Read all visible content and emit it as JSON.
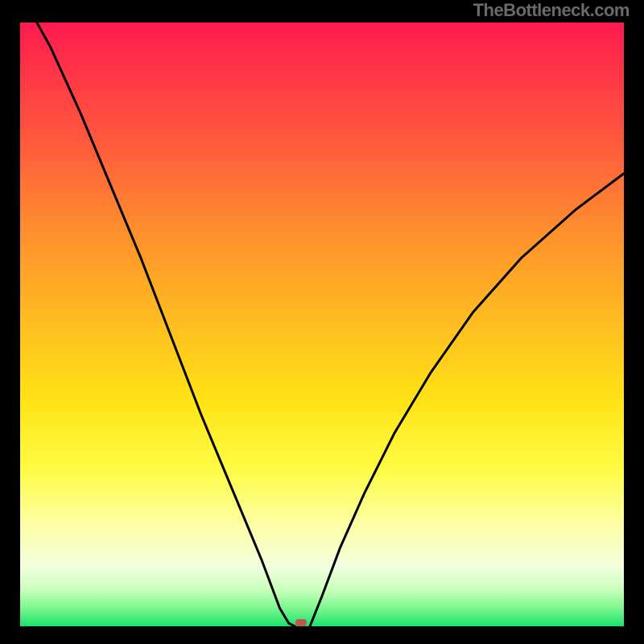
{
  "attribution": "TheBottleneck.com",
  "chart_data": {
    "type": "line",
    "title": "",
    "xlabel": "",
    "ylabel": "",
    "xlim": [
      0,
      100
    ],
    "ylim": [
      0,
      100
    ],
    "series": [
      {
        "name": "bottleneck-curve-left",
        "x": [
          0,
          5,
          10,
          15,
          20,
          25,
          30,
          35,
          40,
          43,
          44.5,
          45.5
        ],
        "values": [
          105,
          96,
          85,
          73,
          61,
          48,
          35,
          23,
          11,
          3,
          0.5,
          0
        ]
      },
      {
        "name": "bottleneck-curve-right",
        "x": [
          48,
          50,
          53,
          57,
          62,
          68,
          75,
          83,
          92,
          100
        ],
        "values": [
          0,
          5,
          13,
          22,
          32,
          42,
          52,
          61,
          69,
          75
        ]
      }
    ],
    "marker": {
      "x": 46.5,
      "y": 0
    },
    "gradient_stops": [
      {
        "offset": 0,
        "color": "#ff1a4f"
      },
      {
        "offset": 50,
        "color": "#ffd21a"
      },
      {
        "offset": 100,
        "color": "#19e36f"
      }
    ]
  },
  "colors": {
    "frame": "#000000",
    "curve": "#000000",
    "marker": "#c0564f",
    "attribution_text": "#6a6a6a"
  }
}
